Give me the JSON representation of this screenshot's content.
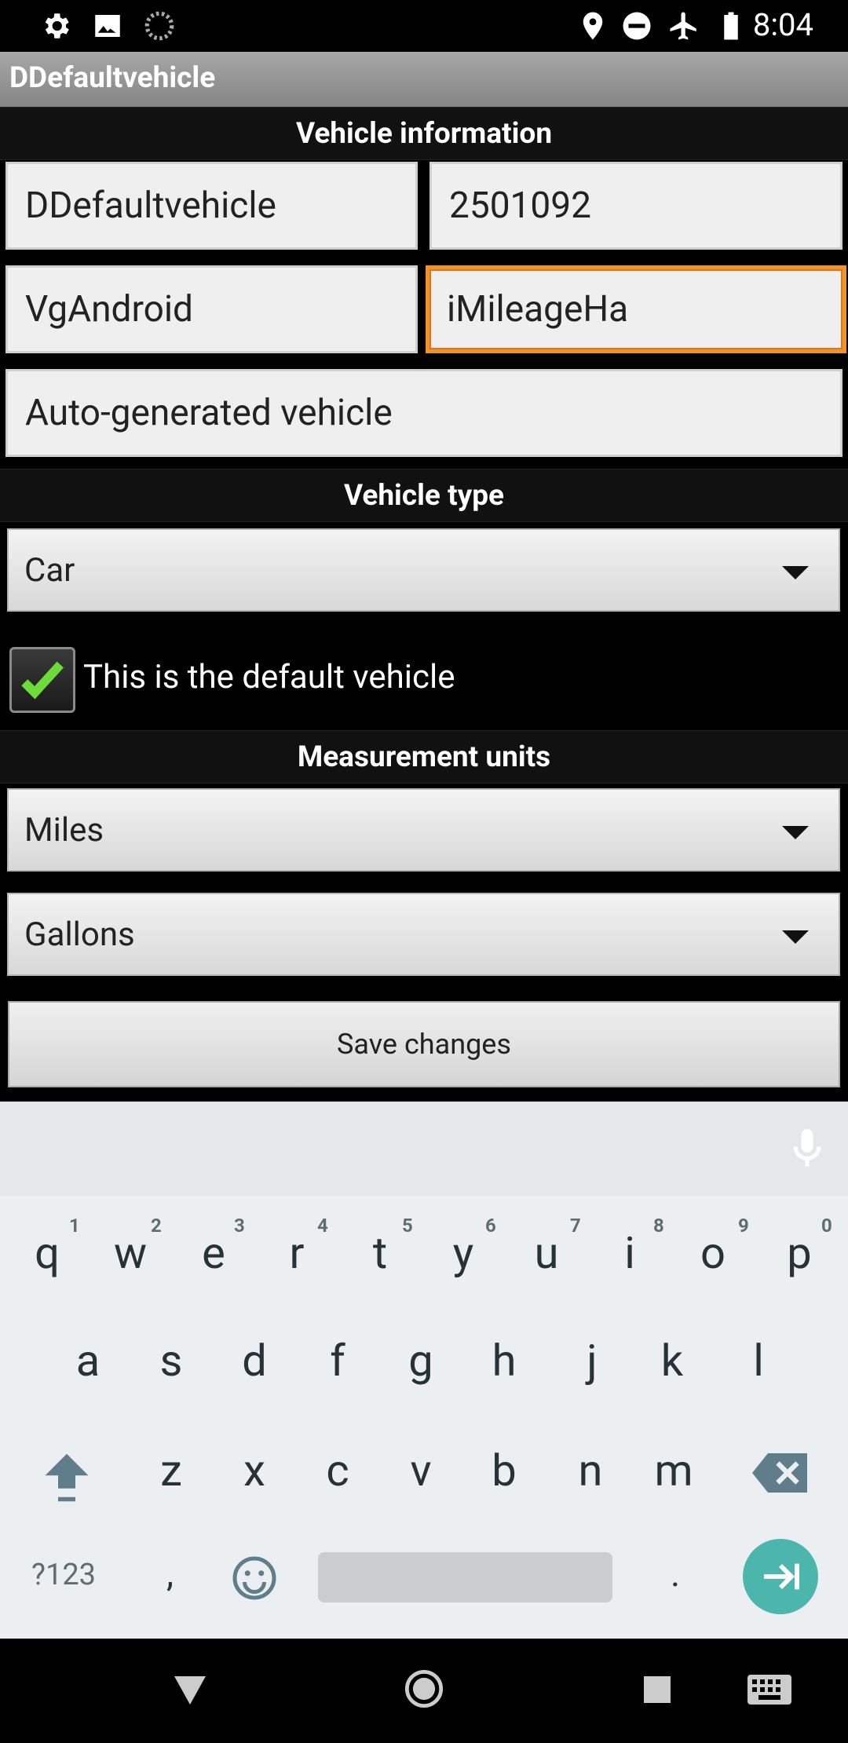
{
  "status_bar": {
    "time": "8:04",
    "left_icons": [
      "gear-icon",
      "image-icon",
      "sync-spinner-icon"
    ],
    "right_icons": [
      "location-icon",
      "do-not-disturb-icon",
      "airplane-mode-icon",
      "battery-icon"
    ]
  },
  "app": {
    "title": "DDefaultvehicle"
  },
  "vehicle_info": {
    "header": "Vehicle information",
    "name": "DDefaultvehicle",
    "number": "2501092",
    "make": "VgAndroid",
    "model": "iMileageHa",
    "description": "Auto-generated vehicle"
  },
  "vehicle_type": {
    "header": "Vehicle type",
    "selected": "Car"
  },
  "default_vehicle": {
    "label": "This is the default vehicle",
    "checked": true
  },
  "measurement_units": {
    "header": "Measurement units",
    "distance_selected": "Miles",
    "volume_selected": "Gallons"
  },
  "actions": {
    "save_label": "Save changes"
  },
  "keyboard": {
    "row1": [
      "q",
      "w",
      "e",
      "r",
      "t",
      "y",
      "u",
      "i",
      "o",
      "p"
    ],
    "row1_hints": [
      "1",
      "2",
      "3",
      "4",
      "5",
      "6",
      "7",
      "8",
      "9",
      "0"
    ],
    "row2": [
      "a",
      "s",
      "d",
      "f",
      "g",
      "h",
      "j",
      "k",
      "l"
    ],
    "row3": [
      "z",
      "x",
      "c",
      "v",
      "b",
      "n",
      "m"
    ],
    "symbols_label": "?123",
    "comma": ",",
    "period": "."
  },
  "colors": {
    "focus_border": "#f2932a",
    "check_green": "#6ddc3a",
    "enter_key": "#4db6ac",
    "titlebar": "#999999"
  }
}
